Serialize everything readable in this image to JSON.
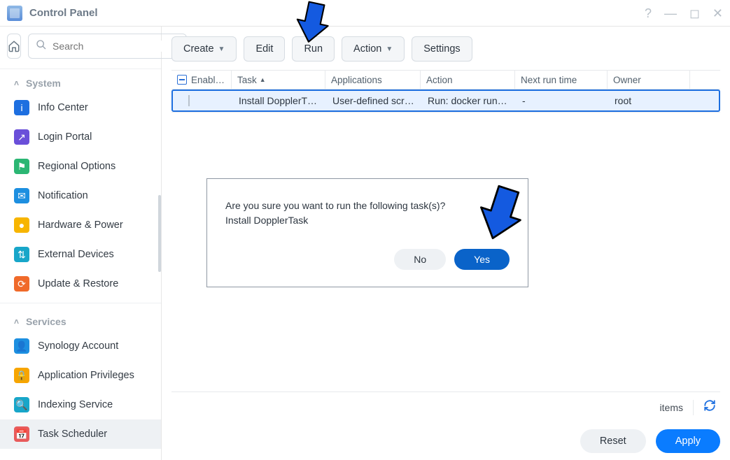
{
  "window_title": "Control Panel",
  "search_placeholder": "Search",
  "sidebar": {
    "groups": [
      {
        "label": "System",
        "items": [
          {
            "label": "Info Center",
            "icon_bg": "#1d6fe0",
            "icon_glyph": "i"
          },
          {
            "label": "Login Portal",
            "icon_bg": "#6a4fd9",
            "icon_glyph": "↗"
          },
          {
            "label": "Regional Options",
            "icon_bg": "#2bb673",
            "icon_glyph": "⚑"
          },
          {
            "label": "Notification",
            "icon_bg": "#1d8fe0",
            "icon_glyph": "✉"
          },
          {
            "label": "Hardware & Power",
            "icon_bg": "#f7b500",
            "icon_glyph": "●"
          },
          {
            "label": "External Devices",
            "icon_bg": "#18a6c9",
            "icon_glyph": "⇅"
          },
          {
            "label": "Update & Restore",
            "icon_bg": "#f06a2a",
            "icon_glyph": "⟳"
          }
        ]
      },
      {
        "label": "Services",
        "items": [
          {
            "label": "Synology Account",
            "icon_bg": "#1d8fe0",
            "icon_glyph": "👤"
          },
          {
            "label": "Application Privileges",
            "icon_bg": "#f7a500",
            "icon_glyph": "🔒"
          },
          {
            "label": "Indexing Service",
            "icon_bg": "#18a6c9",
            "icon_glyph": "🔍"
          },
          {
            "label": "Task Scheduler",
            "icon_bg": "#e85b5b",
            "icon_glyph": "📅",
            "active": true
          }
        ]
      }
    ]
  },
  "toolbar": {
    "create": "Create",
    "edit": "Edit",
    "run": "Run",
    "action": "Action",
    "settings": "Settings"
  },
  "table": {
    "headers": {
      "enabled": "Enabl…",
      "task": "Task",
      "applications": "Applications",
      "action": "Action",
      "next_run": "Next run time",
      "owner": "Owner"
    },
    "rows": [
      {
        "task": "Install DopplerT…",
        "applications": "User-defined scr…",
        "action": "Run: docker run…",
        "next_run": "-",
        "owner": "root"
      }
    ]
  },
  "footer": {
    "items_label": "items",
    "reset": "Reset",
    "apply": "Apply"
  },
  "dialog": {
    "message": "Are you sure you want to run the following task(s)?",
    "detail": "Install DopplerTask",
    "no": "No",
    "yes": "Yes"
  }
}
